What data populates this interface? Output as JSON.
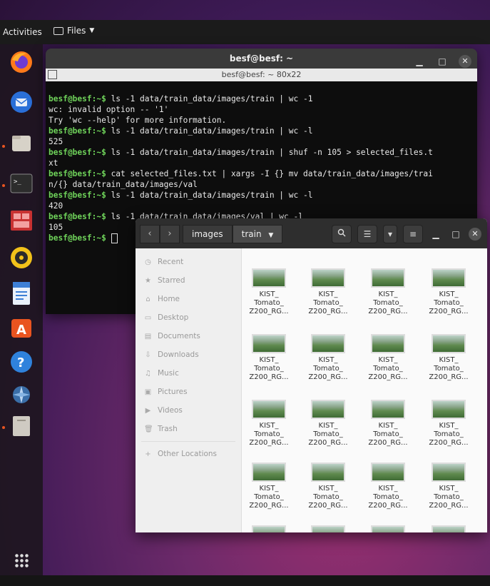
{
  "topbar": {
    "activities": "Activities",
    "app_menu": "Files"
  },
  "terminal": {
    "title": "besf@besf: ~",
    "subtitle": "besf@besf: ~ 80x22",
    "lines": [
      {
        "prompt": "besf@besf:~$ ",
        "text": "ls -1 data/train_data/images/train | wc -1"
      },
      {
        "prompt": "",
        "text": "wc: invalid option -- '1'"
      },
      {
        "prompt": "",
        "text": "Try 'wc --help' for more information."
      },
      {
        "prompt": "besf@besf:~$ ",
        "text": "ls -1 data/train_data/images/train | wc -l"
      },
      {
        "prompt": "",
        "text": "525"
      },
      {
        "prompt": "besf@besf:~$ ",
        "text": "ls -1 data/train_data/images/train | shuf -n 105 > selected_files.t"
      },
      {
        "prompt": "",
        "text": "xt"
      },
      {
        "prompt": "besf@besf:~$ ",
        "text": "cat selected_files.txt | xargs -I {} mv data/train_data/images/trai"
      },
      {
        "prompt": "",
        "text": "n/{} data/train_data/images/val"
      },
      {
        "prompt": "besf@besf:~$ ",
        "text": "ls -1 data/train_data/images/train | wc -l"
      },
      {
        "prompt": "",
        "text": "420"
      },
      {
        "prompt": "besf@besf:~$ ",
        "text": "ls -1 data/train_data/images/val | wc -l"
      },
      {
        "prompt": "",
        "text": "105"
      },
      {
        "prompt": "besf@besf:~$ ",
        "text": ""
      }
    ]
  },
  "files": {
    "breadcrumbs": [
      "images",
      "train"
    ],
    "sidebar": [
      {
        "label": "Recent",
        "icon": "clock-icon"
      },
      {
        "label": "Starred",
        "icon": "star-icon"
      },
      {
        "label": "Home",
        "icon": "home-icon"
      },
      {
        "label": "Desktop",
        "icon": "desktop-icon"
      },
      {
        "label": "Documents",
        "icon": "document-icon"
      },
      {
        "label": "Downloads",
        "icon": "download-icon"
      },
      {
        "label": "Music",
        "icon": "music-icon"
      },
      {
        "label": "Pictures",
        "icon": "picture-icon"
      },
      {
        "label": "Videos",
        "icon": "video-icon"
      },
      {
        "label": "Trash",
        "icon": "trash-icon"
      },
      {
        "label": "Other Locations",
        "icon": "plus-icon"
      }
    ],
    "file_label": "KIST_\nTomato_\nZ200_RG...",
    "file_count_visible": 16
  }
}
